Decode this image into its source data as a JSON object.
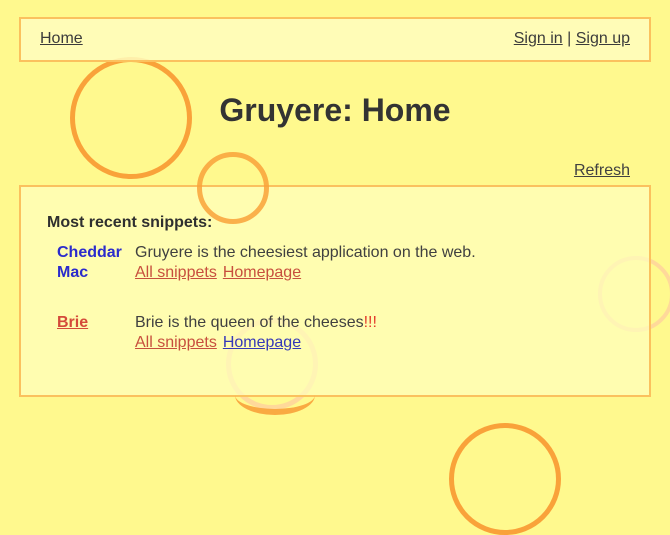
{
  "nav": {
    "home_label": "Home",
    "sign_in_label": "Sign in",
    "separator": "|",
    "sign_up_label": "Sign up"
  },
  "page": {
    "title": "Gruyere: Home",
    "refresh_label": "Refresh"
  },
  "snippets_panel": {
    "heading": "Most recent snippets:",
    "items": [
      {
        "author": "Cheddar Mac",
        "text": "Gruyere is the cheesiest application on the web.",
        "text_emphasis": "",
        "link_all": "All snippets",
        "link_home": "Homepage"
      },
      {
        "author": "Brie",
        "text": "Brie is the queen of the cheeses",
        "text_emphasis": "!!!",
        "link_all": "All snippets",
        "link_home": "Homepage"
      }
    ]
  },
  "colors": {
    "background": "#FFF98E",
    "border": "#FBC15E",
    "circle_accent": "#F9A23A",
    "author_blue": "#2B2BCC",
    "link_red": "#C74F3E",
    "link_blue": "#3538B8"
  }
}
